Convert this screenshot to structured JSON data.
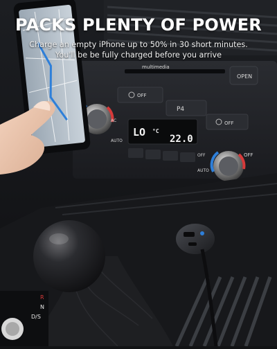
{
  "headline": "PACKS PLENTY OF POWER",
  "subtext": {
    "line1": "Charge an empty iPhone up to 50% in 30 short minutes.",
    "line2": "You'll be be fully charged before you arrive"
  },
  "dashboard": {
    "multimedia_label": "multimedia",
    "open_button": "OPEN",
    "off_button_left": "OFF",
    "off_button_mid": "OFF",
    "off_button_right": "OFF",
    "ac_label": "AC",
    "auto_left": "AUTO",
    "auto_right": "AUTO",
    "off_small": "OFF",
    "lcd_left": "LO",
    "lcd_right": "22.0",
    "lcd_unit": "°C"
  },
  "shifter_labels": {
    "r": "R",
    "n": "N",
    "d": "D/S"
  },
  "colors": {
    "accent_blue": "#2e7fd9",
    "accent_red": "#d63a3a",
    "lcd_bg": "#0a0b0c"
  }
}
